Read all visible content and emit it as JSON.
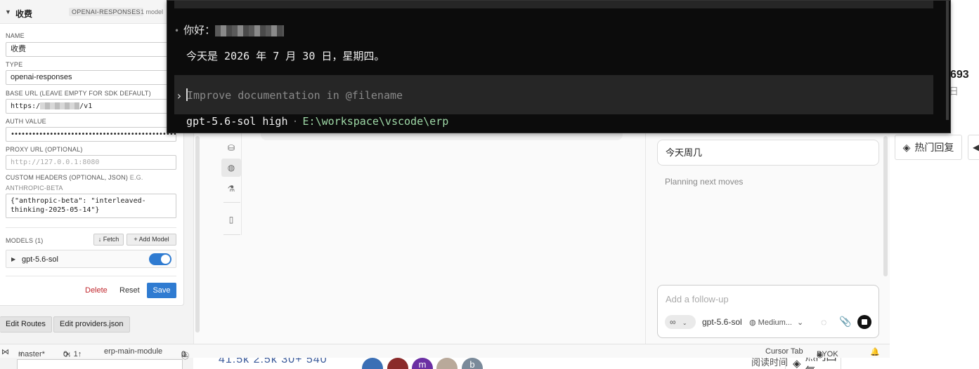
{
  "provider": {
    "name": "收费",
    "type_badge": "OPENAI-RESPONSES",
    "model_count": "1 model",
    "fields": {
      "name_label": "NAME",
      "name_value": "收费",
      "type_label": "TYPE",
      "type_value": "openai-responses",
      "base_url_label": "BASE URL (LEAVE EMPTY FOR SDK DEFAULT)",
      "base_url_prefix": "https:/",
      "base_url_suffix": "/v1",
      "auth_label": "AUTH VALUE",
      "auth_value": "••••••••••••••••••••••••••••••••••••••••••••••••",
      "proxy_label": "PROXY URL (OPTIONAL)",
      "proxy_placeholder": "http://127.0.0.1:8080",
      "headers_label": "CUSTOM HEADERS (OPTIONAL, JSON)",
      "headers_hint_1": "E.G.",
      "headers_hint_2": "ANTHROPIC-BETA",
      "headers_value": "{\"anthropic-beta\": \"interleaved-thinking-2025-05-14\"}"
    },
    "models_label": "MODELS (1)",
    "fetch_label": "↓ Fetch",
    "add_model_label": "+ Add Model",
    "models": [
      {
        "name": "gpt-5.6-sol",
        "enabled": true
      }
    ],
    "delete_label": "Delete",
    "reset_label": "Reset",
    "save_label": "Save"
  },
  "bottom_buttons": {
    "edit_routes": "Edit Routes",
    "edit_providers": "Edit providers.json"
  },
  "terminal": {
    "greeting_prefix": "你好：",
    "date_line": "今天是 2026 年 7 月 30 日，星期四。",
    "input_placeholder": "Improve documentation in @filename",
    "status_model": "gpt-5.6-sol high",
    "status_sep": "·",
    "status_path": "E:\\workspace\\vscode\\erp"
  },
  "chat": {
    "user_message": "今天周几",
    "status_text": "Planning next moves",
    "input_placeholder": "Add a follow-up",
    "mode_icon": "∞",
    "model": "gpt-5.6-sol",
    "effort": "Medium..."
  },
  "status_bar": {
    "branch": "master*",
    "sync": "0↓ 1↑",
    "module": "erp-main-module",
    "problems": "0",
    "warnings": "0",
    "cursor_tab": "Cursor Tab",
    "byok": "BYOK"
  },
  "background_page": {
    "stat_number": "693",
    "stat_sub": "日",
    "hot_reply": "热门回复",
    "bottom_stats": "41.5k 2.5k 30+ 540",
    "bottom_read": "阅读时间",
    "avatar_m": "m",
    "avatar_b": "b"
  },
  "colors": {
    "accent": "#2f7bd1",
    "danger": "#c0272d",
    "terminal_bg": "#0c0c0c",
    "terminal_path": "#9ed8a6"
  }
}
